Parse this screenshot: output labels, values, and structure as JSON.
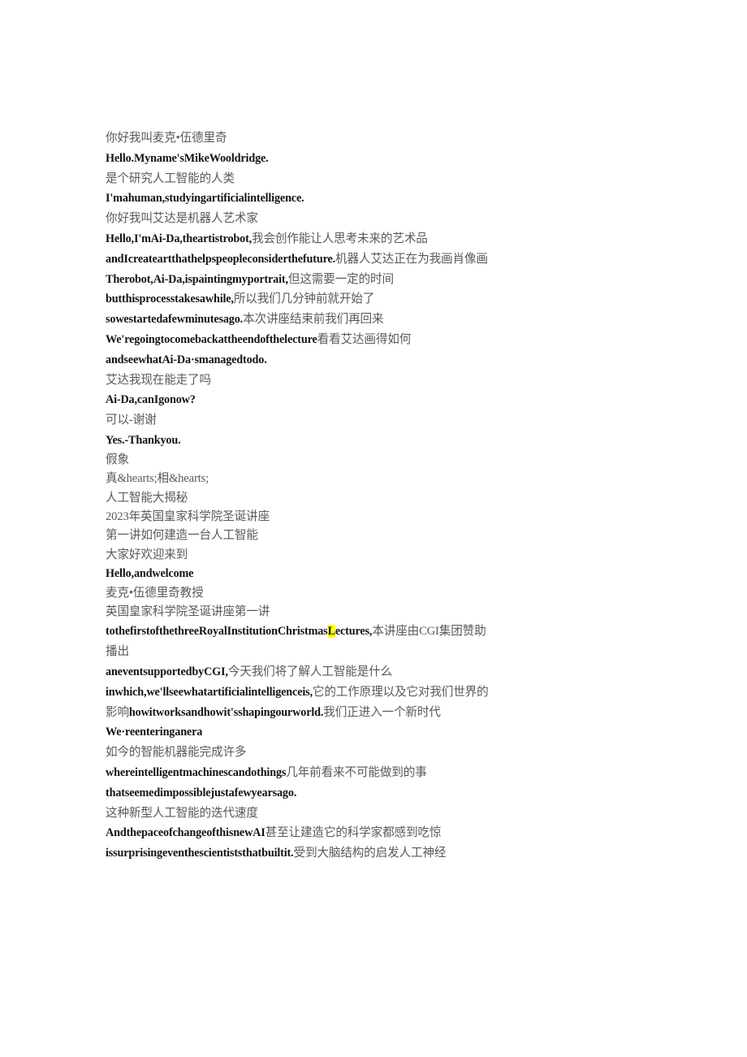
{
  "document": {
    "type": "bilingual-transcript",
    "background_color": "#ffffff",
    "zh_text_color": "#595959",
    "en_text_color": "#141414",
    "highlight_color": "#ffff00",
    "lines": [
      {
        "id": "l1",
        "lang": "zh",
        "text": "你好我叫麦克•伍德里奇"
      },
      {
        "id": "l2",
        "lang": "en",
        "text": "Hello.Myname'sMikeWooldridge."
      },
      {
        "id": "l3",
        "lang": "zh",
        "text": "是个研究人工智能的人类"
      },
      {
        "id": "l4",
        "lang": "en",
        "text": "I'mahuman,studyingartificialintelligence."
      },
      {
        "id": "l5",
        "lang": "zh",
        "text": "你好我叫艾达是机器人艺术家"
      },
      {
        "id": "l6",
        "lang": "mix",
        "runs": [
          {
            "lang": "en",
            "text": "Hello,I'mAi-Da,theartistrobot,"
          },
          {
            "lang": "zh",
            "text": "我会创作能让人思考未来的艺术品"
          }
        ]
      },
      {
        "id": "l7",
        "lang": "mix",
        "runs": [
          {
            "lang": "en",
            "text": "andIcreateartthathelpspeopleconsiderthefuture."
          },
          {
            "lang": "zh",
            "text": "机器人艾达正在为我画肖像画"
          }
        ]
      },
      {
        "id": "l8",
        "lang": "mix",
        "runs": [
          {
            "lang": "en",
            "text": "Therobot,Ai-Da,ispaintingmyportrait,"
          },
          {
            "lang": "zh",
            "text": "但这需要一定的时间"
          }
        ]
      },
      {
        "id": "l9",
        "lang": "mix",
        "runs": [
          {
            "lang": "en",
            "text": "butthisprocesstakesawhile,"
          },
          {
            "lang": "zh",
            "text": "所以我们几分钟前就开始了"
          }
        ]
      },
      {
        "id": "l10",
        "lang": "mix",
        "runs": [
          {
            "lang": "en",
            "text": "sowestartedafewminutesago."
          },
          {
            "lang": "zh",
            "text": "本次讲座结束前我们再回来"
          }
        ]
      },
      {
        "id": "l11",
        "lang": "mix",
        "runs": [
          {
            "lang": "en",
            "text": "We'regoingtocomebackattheendofthelecture"
          },
          {
            "lang": "zh",
            "text": "看看艾达画得如何"
          }
        ]
      },
      {
        "id": "l12",
        "lang": "en",
        "text": "andseewhatAi-Da·smanagedtodo."
      },
      {
        "id": "l13",
        "lang": "zh",
        "text": "艾达我现在能走了吗"
      },
      {
        "id": "l14",
        "lang": "en",
        "text": "Ai-Da,canIgonow?"
      },
      {
        "id": "l15",
        "lang": "zh",
        "text": "可以-谢谢"
      },
      {
        "id": "l16",
        "lang": "en",
        "text": "Yes.-Thankyou."
      },
      {
        "id": "l17",
        "lang": "zh",
        "text": "假象"
      },
      {
        "id": "l18",
        "lang": "zh",
        "text": "真&hearts;相&hearts;"
      },
      {
        "id": "l19",
        "lang": "zh",
        "text": "人工智能大揭秘"
      },
      {
        "id": "l20",
        "lang": "zh",
        "text": "2023年英国皇家科学院圣诞讲座"
      },
      {
        "id": "l21",
        "lang": "zh",
        "text": "第一讲如何建造一台人工智能"
      },
      {
        "id": "l22",
        "lang": "zh",
        "text": "大家好欢迎来到"
      },
      {
        "id": "l23",
        "lang": "en",
        "text": "Hello,andwelcome"
      },
      {
        "id": "l24",
        "lang": "zh",
        "text": "麦克•伍德里奇教授"
      },
      {
        "id": "l25",
        "lang": "zh",
        "text": "英国皇家科学院圣诞讲座第一讲"
      },
      {
        "id": "l26",
        "lang": "mix",
        "runs": [
          {
            "lang": "en",
            "text": "tothefirstofthethreeRoyalInstitutionChristmas"
          },
          {
            "lang": "en",
            "text": "L",
            "highlight": true
          },
          {
            "lang": "en",
            "text": "ectures,"
          },
          {
            "lang": "zh",
            "text": "本讲座由CGI集团赞助播出"
          }
        ]
      },
      {
        "id": "l27",
        "lang": "mix",
        "runs": [
          {
            "lang": "en",
            "text": "aneventsupportedbyCGI,"
          },
          {
            "lang": "zh",
            "text": "今天我们将了解人工智能是什么"
          }
        ]
      },
      {
        "id": "l28",
        "lang": "mix",
        "runs": [
          {
            "lang": "en",
            "text": "inwhich,we'llseewhatartificialintelligenceis,"
          },
          {
            "lang": "zh",
            "text": "它的工作原理以及它对我们世界的影响"
          },
          {
            "lang": "en",
            "text": "howitworksandhowit'sshapingourworld."
          },
          {
            "lang": "zh",
            "text": "我们正进入一个新时代"
          }
        ]
      },
      {
        "id": "l29",
        "lang": "en",
        "text": "We·reenteringanera"
      },
      {
        "id": "l30",
        "lang": "zh",
        "text": "如今的智能机器能完成许多"
      },
      {
        "id": "l31",
        "lang": "mix",
        "runs": [
          {
            "lang": "en",
            "text": "whereintelligentmachinescandothings"
          },
          {
            "lang": "zh",
            "text": "几年前看来不可能做到的事"
          }
        ]
      },
      {
        "id": "l32",
        "lang": "en",
        "text": "thatseemedimpossiblejustafewyearsago."
      },
      {
        "id": "l33",
        "lang": "zh",
        "text": "这种新型人工智能的迭代速度"
      },
      {
        "id": "l34",
        "lang": "mix",
        "runs": [
          {
            "lang": "en",
            "text": "AndthepaceofchangeofthisnewAI"
          },
          {
            "lang": "zh",
            "text": "甚至让建造它的科学家都感到吃惊"
          }
        ]
      },
      {
        "id": "l35",
        "lang": "mix",
        "runs": [
          {
            "lang": "en",
            "text": "issurprisingeventhescientiststhatbuiltit."
          },
          {
            "lang": "zh",
            "text": "受到大脑结构的启发人工神经"
          }
        ]
      }
    ]
  }
}
